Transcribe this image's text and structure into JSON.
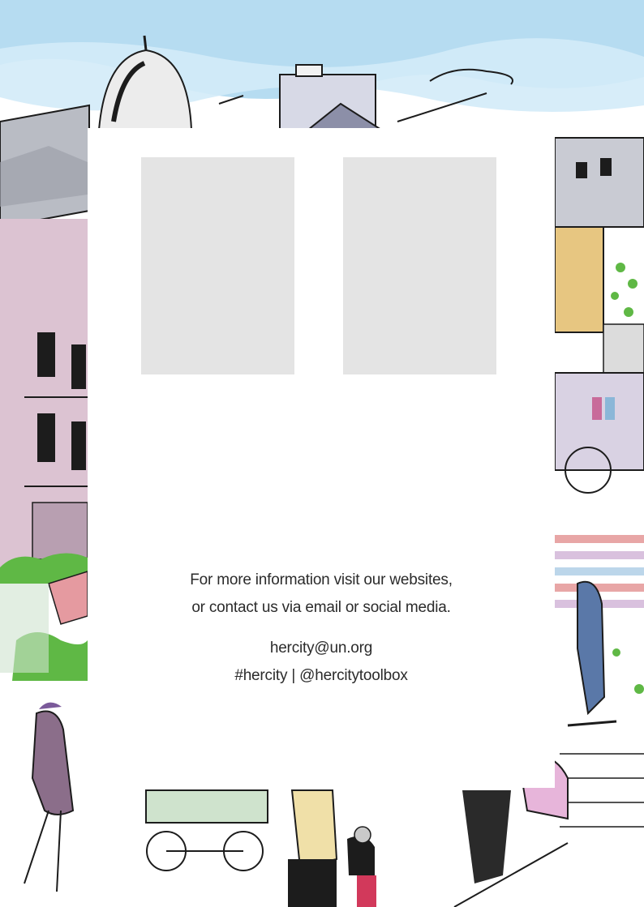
{
  "info": {
    "line1": "For more information visit our websites,",
    "line2": "or contact us via email or social media."
  },
  "contact": {
    "email": "hercity@un.org",
    "social": "#hercity | @hercitytoolbox"
  },
  "colors": {
    "sky": "#a9d6ef",
    "placeholder": "#e4e4e4",
    "card": "#ffffff",
    "text": "#2b2b2b",
    "building_pink": "#dcc3d2",
    "foliage_green": "#5fb845",
    "ink": "#1c1c1c"
  }
}
